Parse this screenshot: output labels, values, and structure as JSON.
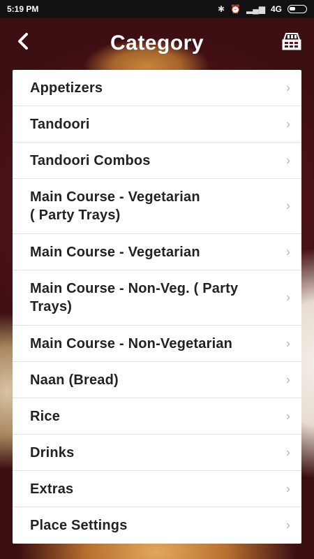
{
  "status_bar": {
    "time": "5:19 PM",
    "network": "4G"
  },
  "header": {
    "title": "Category",
    "back_icon": "back-arrow-icon",
    "cart_icon": "menu-box-icon"
  },
  "categories": [
    {
      "label": "Appetizers"
    },
    {
      "label": "Tandoori"
    },
    {
      "label": "Tandoori Combos"
    },
    {
      "label": "Main Course - Vegetarian\n( Party Trays)"
    },
    {
      "label": "Main Course - Vegetarian"
    },
    {
      "label": "Main Course - Non-Veg. ( Party Trays)"
    },
    {
      "label": "Main Course - Non-Vegetarian"
    },
    {
      "label": "Naan (Bread)"
    },
    {
      "label": "Rice"
    },
    {
      "label": "Drinks"
    },
    {
      "label": "Extras"
    },
    {
      "label": "Place Settings"
    }
  ]
}
